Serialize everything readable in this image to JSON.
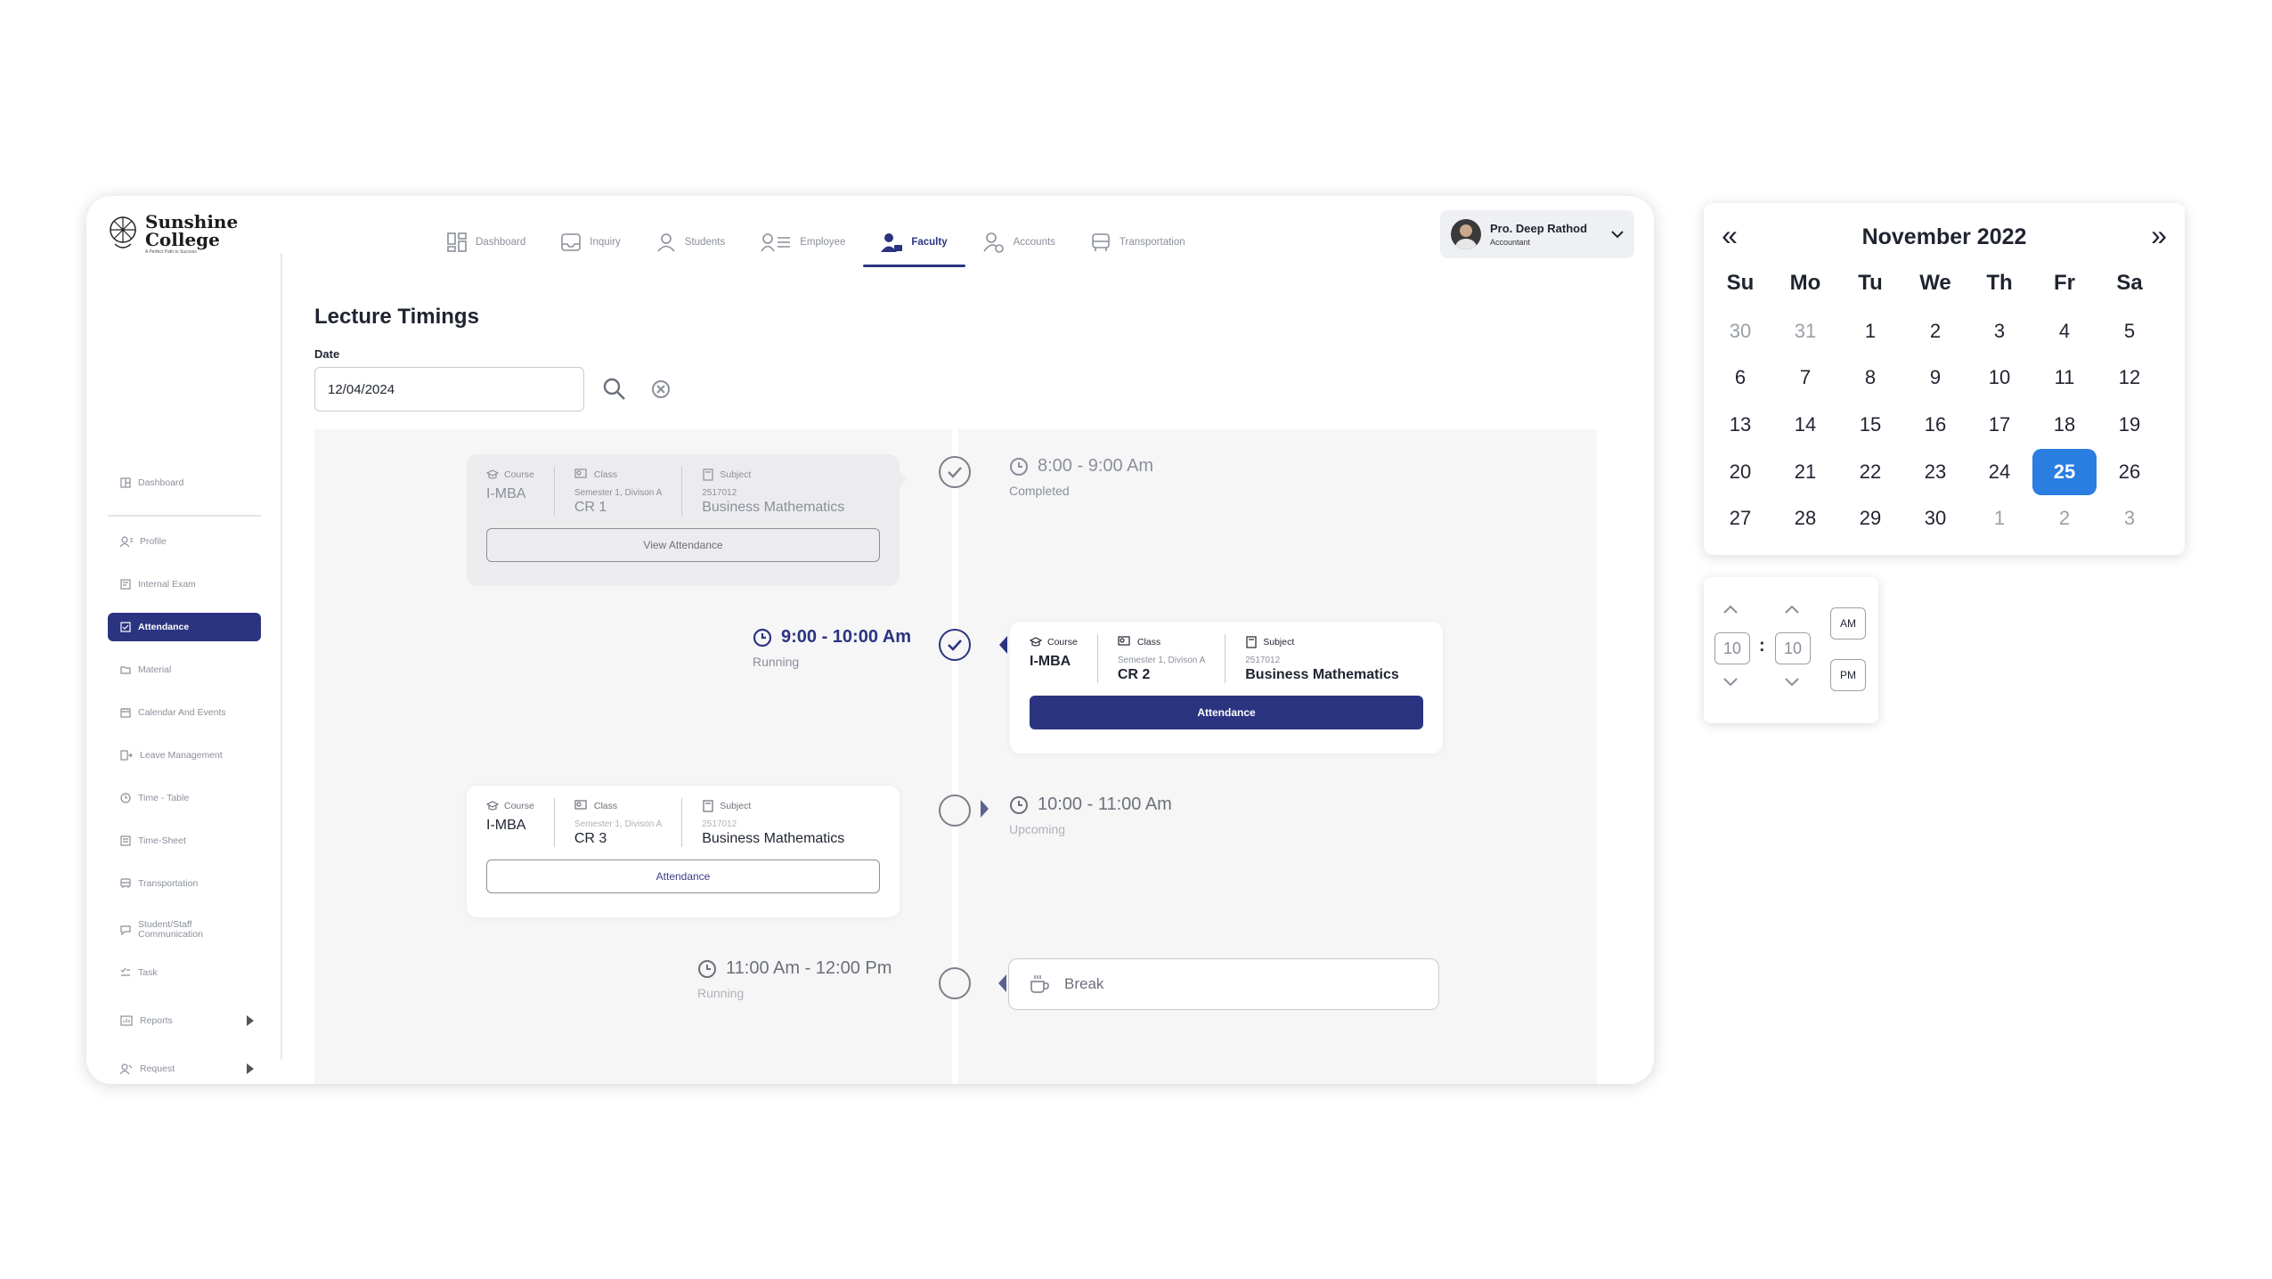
{
  "app": {
    "logo": {
      "line1": "Sunshine",
      "line2": "College",
      "tagline": "A Perfect Path to Success"
    },
    "topnav": [
      {
        "label": "Dashboard",
        "icon": "grid-icon"
      },
      {
        "label": "Inquiry",
        "icon": "inbox-icon"
      },
      {
        "label": "Students",
        "icon": "person-icon"
      },
      {
        "label": "Employee",
        "icon": "employee-list-icon"
      },
      {
        "label": "Faculty",
        "icon": "faculty-icon",
        "active": true
      },
      {
        "label": "Accounts",
        "icon": "accounts-icon"
      },
      {
        "label": "Transportation",
        "icon": "bus-icon"
      }
    ],
    "user": {
      "name": "Pro. Deep Rathod",
      "role": "Accountant"
    },
    "sidebar": [
      {
        "label": "Dashboard",
        "icon": "dashboard-icon"
      },
      {
        "label": "Profile",
        "icon": "profile-icon"
      },
      {
        "label": "Internal Exam",
        "icon": "exam-icon"
      },
      {
        "label": "Attendance",
        "icon": "attendance-icon",
        "active": true
      },
      {
        "label": "Material",
        "icon": "folder-icon"
      },
      {
        "label": "Calendar And Events",
        "icon": "calendar-icon"
      },
      {
        "label": "Leave Management",
        "icon": "leave-icon"
      },
      {
        "label": "Time - Table",
        "icon": "clock-icon"
      },
      {
        "label": "Time-Sheet",
        "icon": "timesheet-icon"
      },
      {
        "label": "Transportation",
        "icon": "bus-icon"
      },
      {
        "label": "Student/Staff",
        "label2": "Communication",
        "icon": "chat-icon"
      },
      {
        "label": "Task",
        "icon": "task-icon"
      },
      {
        "label": "Reports",
        "icon": "reports-icon",
        "expandable": true
      },
      {
        "label": "Request",
        "icon": "request-icon",
        "expandable": true
      }
    ]
  },
  "page": {
    "title": "Lecture Timings",
    "date_label": "Date",
    "date_value": "12/04/2024"
  },
  "card_labels": {
    "course": "Course",
    "class": "Class",
    "subject": "Subject"
  },
  "lectures": [
    {
      "time": "8:00 - 9:00 Am",
      "status": "Completed",
      "course": "I-MBA",
      "class_sub": "Semester 1, Divison A",
      "class_room": "CR 1",
      "subject_code": "2517012",
      "subject": "Business Mathematics",
      "button": "View Attendance"
    },
    {
      "time": "9:00 - 10:00 Am",
      "status": "Running",
      "course": "I-MBA",
      "class_sub": "Semester 1, Divison A",
      "class_room": "CR 2",
      "subject_code": "2517012",
      "subject": "Business Mathematics",
      "button": "Attendance"
    },
    {
      "time": "10:00 - 11:00 Am",
      "status": "Upcoming",
      "course": "I-MBA",
      "class_sub": "Semester 1, Divison A",
      "class_room": "CR 3",
      "subject_code": "2517012",
      "subject": "Business Mathematics",
      "button": "Attendance"
    },
    {
      "time": "11:00 Am - 12:00 Pm",
      "status": "Running",
      "break_label": "Break"
    }
  ],
  "calendar": {
    "title": "November 2022",
    "prev": "«",
    "next": "»",
    "weekdays": [
      "Su",
      "Mo",
      "Tu",
      "We",
      "Th",
      "Fr",
      "Sa"
    ],
    "weeks": [
      [
        "30",
        "31",
        "1",
        "2",
        "3",
        "4",
        "5"
      ],
      [
        "6",
        "7",
        "8",
        "9",
        "10",
        "11",
        "12"
      ],
      [
        "13",
        "14",
        "15",
        "16",
        "17",
        "18",
        "19"
      ],
      [
        "20",
        "21",
        "22",
        "23",
        "24",
        "25",
        "26"
      ],
      [
        "27",
        "28",
        "29",
        "30",
        "1",
        "2",
        "3"
      ]
    ],
    "selected": "25",
    "accent": "#2a7de1"
  },
  "timepicker": {
    "hour": "10",
    "minute": "10",
    "separator": ":",
    "am": "AM",
    "pm": "PM"
  },
  "colors": {
    "primary": "#2b3480",
    "muted": "#8a8f99"
  }
}
